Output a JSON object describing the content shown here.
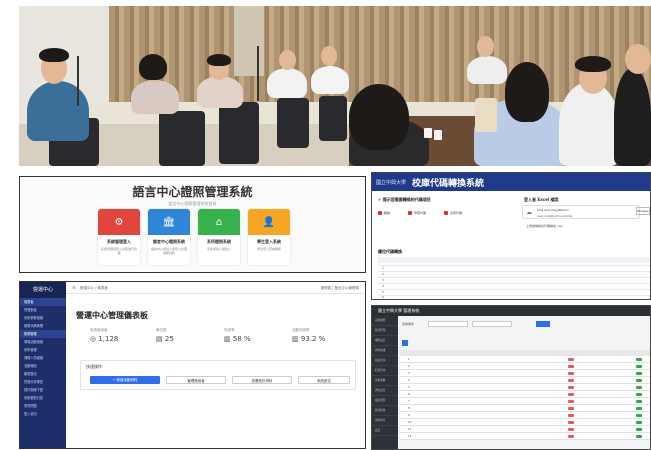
{
  "panel_lang": {
    "title": "語言中心證照管理系統",
    "subtitle": "語言中心證照管理系統首頁",
    "cards": [
      {
        "label": "系統管理登入",
        "desc": "系統管理員登入系統進行管理",
        "color": "#e0463c",
        "icon": "gear-icon"
      },
      {
        "label": "語言中心證照系統",
        "desc": "語言中心承辦人員登入管理證照資料",
        "color": "#2f86d6",
        "icon": "bank-icon"
      },
      {
        "label": "系所證照系統",
        "desc": "系所承辦人員登入",
        "color": "#37b24d",
        "icon": "home-icon"
      },
      {
        "label": "學生登入系統",
        "desc": "學生登入查詢證照",
        "color": "#f5a623",
        "icon": "user-icon"
      }
    ]
  },
  "panel_transcode": {
    "logo": "國立中興大學",
    "title": "校庫代碼轉換系統",
    "section_notice": "✔ 提示您需要轉換的代碼項目",
    "tags": [
      "職稱",
      "學院代碼",
      "系所代碼"
    ],
    "user_block": {
      "title": "登入者 Excel 檔案",
      "name": "Ling and Amy/Person",
      "email": "user.mail@nchu.edu.tw"
    },
    "file_label": "上傳欲轉換的代碼檔案 xlsx",
    "button": "Browse",
    "section_table": "欄位代碼轉換",
    "rows": [
      "1",
      "2",
      "3",
      "4",
      "5",
      "6"
    ]
  },
  "panel_dashboard": {
    "brand": "營運中心",
    "nav": [
      "儀表板",
      "營運數據",
      "系統參數維護",
      "權限代碼管理",
      "帳號管理",
      "現場活動維護",
      "系所管理",
      "課程人員維護",
      "活動報到",
      "報表匯出",
      "營運分析專區",
      "操作指南下載",
      "系統更新日誌",
      "常見問題",
      "登入資訊"
    ],
    "breadcrumb": "營運中心 / 儀表板",
    "user": "管理員 | 登出中心管理員",
    "title": "營運中心管理儀表板",
    "stats": [
      {
        "label": "系統使用者",
        "value": "1,128",
        "icon": "user-icon"
      },
      {
        "label": "單位數",
        "value": "25",
        "icon": "doc-icon"
      },
      {
        "label": "完成率",
        "value": "58 %",
        "icon": "chart-icon"
      },
      {
        "label": "活動完成率",
        "value": "93.2 %",
        "icon": "chart-icon"
      }
    ],
    "quick_title": "快速操作",
    "buttons": [
      "+ 新增活動資料",
      "管理使用者",
      "查看統計資料",
      "系統設定"
    ]
  },
  "panel_admin": {
    "header": "國立中興大學 管理系統",
    "nav": [
      "系統概覽",
      "帳號管理",
      "權限設定",
      "資料維護",
      "報表查詢",
      "紀錄查詢",
      "系統參數",
      "通知設定",
      "檔案管理",
      "操作紀錄",
      "資料匯出",
      "設定"
    ],
    "filter_label": "查詢條件",
    "rows": [
      "1",
      "2",
      "3",
      "4",
      "5",
      "6",
      "7",
      "8",
      "9",
      "10",
      "11",
      "12"
    ]
  }
}
